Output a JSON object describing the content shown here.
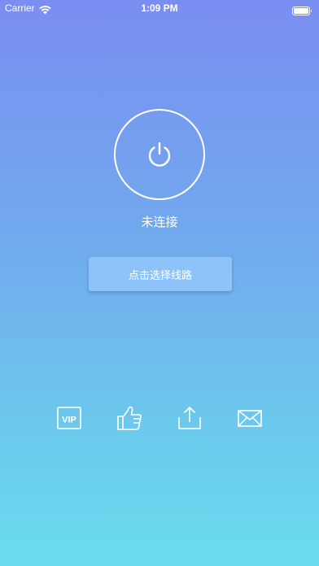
{
  "status_bar": {
    "carrier": "Carrier",
    "time": "1:09 PM"
  },
  "main": {
    "connection_status": "未连接",
    "select_route_label": "点击选择线路"
  },
  "toolbar": {
    "vip_label": "VIP"
  },
  "icons": [
    "wifi-icon",
    "battery-icon",
    "power-icon",
    "vip-icon",
    "thumbs-up-icon",
    "share-icon",
    "mail-icon"
  ],
  "colors": {
    "gradient_top": "#7A8EF1",
    "gradient_bottom": "#6ADDEF",
    "button_bg": "#8EC3FA",
    "foreground": "#FFFFFF"
  }
}
